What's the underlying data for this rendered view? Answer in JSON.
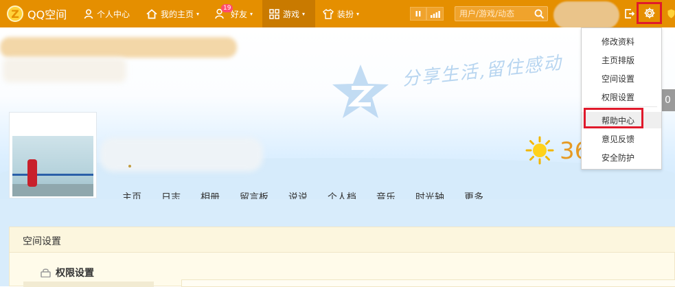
{
  "topbar": {
    "logo_mark": "Z",
    "logo_text": "QQ空间",
    "nav": [
      {
        "label": "个人中心",
        "icon": "person-icon"
      },
      {
        "label": "我的主页",
        "icon": "home-icon",
        "caret": "▾"
      },
      {
        "label": "好友",
        "icon": "friends-icon",
        "badge": "19",
        "caret": "▾"
      },
      {
        "label": "游戏",
        "icon": "grid-icon",
        "caret": "▾",
        "active": true
      },
      {
        "label": "装扮",
        "icon": "shirt-icon",
        "caret": "▾"
      }
    ],
    "search_placeholder": "用户/游戏/动态"
  },
  "banner": {
    "slogan": "分享生活,留住感动",
    "temperature": "36",
    "right_tab": "0",
    "tabs": [
      "主页",
      "日志",
      "相册",
      "留言板",
      "说说",
      "个人档",
      "音乐",
      "时光轴",
      "更多"
    ]
  },
  "content": {
    "panel_title": "空间设置",
    "section_label": "权限设置"
  },
  "settings_menu": {
    "items": [
      "修改资料",
      "主页排版",
      "空间设置",
      "权限设置",
      "帮助中心",
      "意见反馈",
      "安全防护"
    ],
    "highlighted": "帮助中心"
  },
  "colors": {
    "topbar": "#e58f00",
    "highlight_border": "#e0192b",
    "temperature": "#e69a23"
  }
}
